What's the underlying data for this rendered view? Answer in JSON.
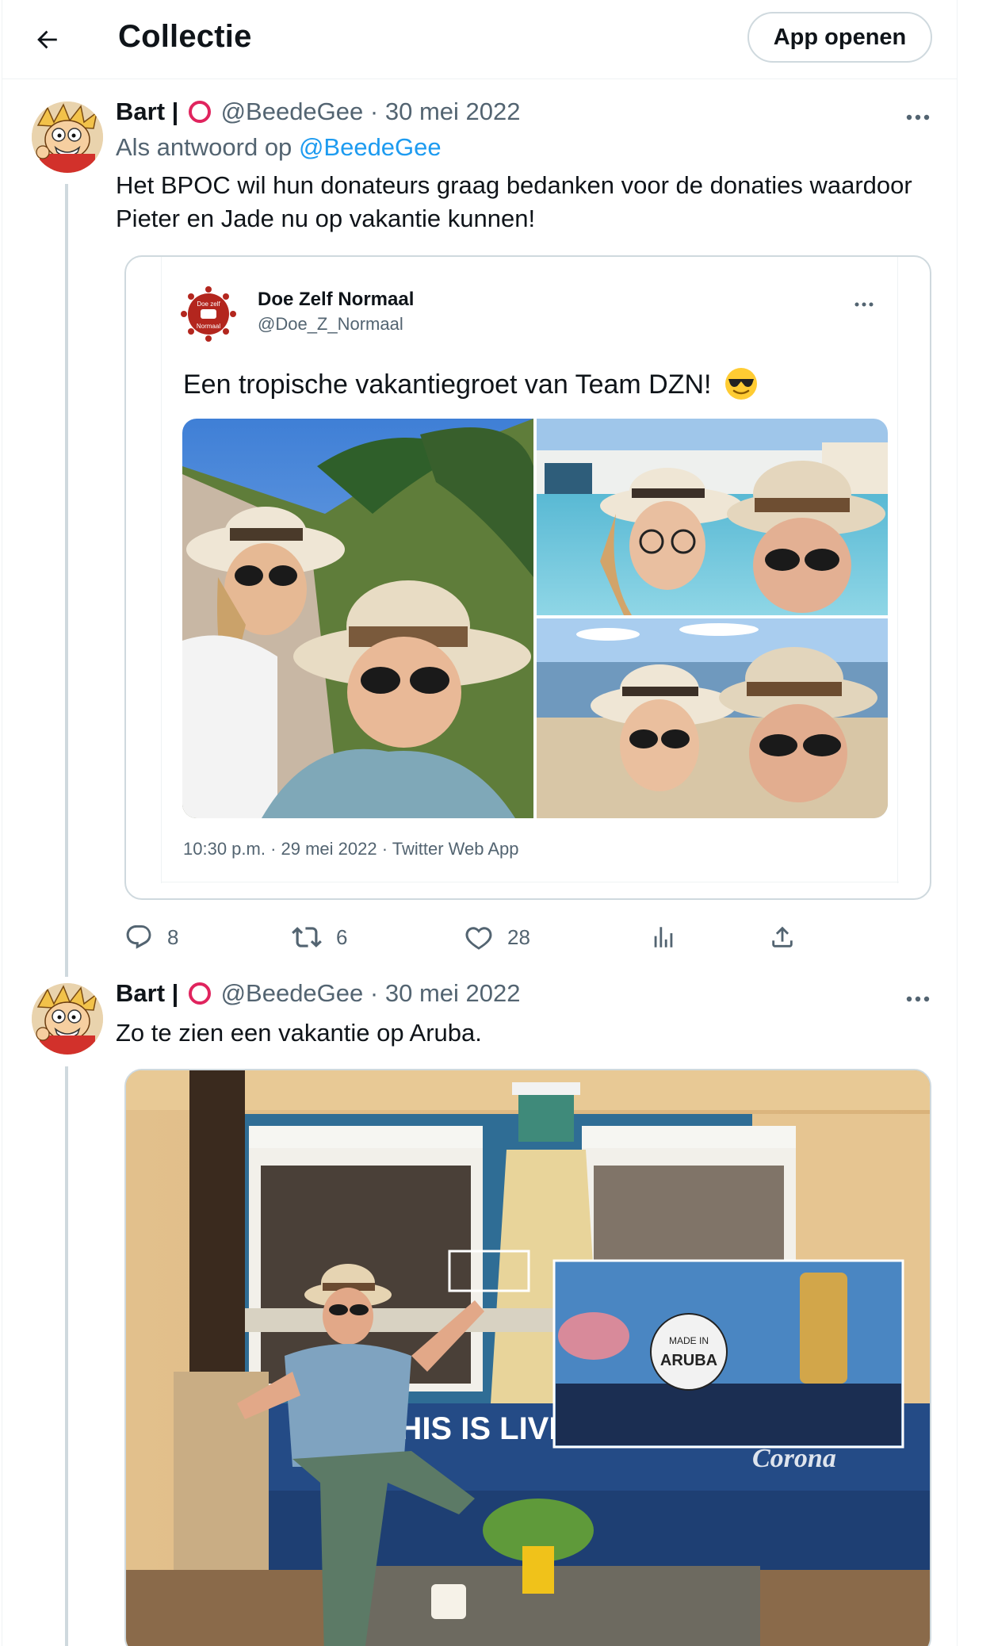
{
  "header": {
    "title": "Collectie",
    "open_app_label": "App openen"
  },
  "tweets": [
    {
      "name": "Bart |",
      "handle": "@BeedeGee",
      "dot": "·",
      "date": "30 mei 2022",
      "reply_prefix": "Als antwoord op",
      "reply_mention": "@BeedeGee",
      "text": "Het BPOC wil hun donateurs graag bedanken voor de donaties waardoor Pieter en Jade nu op vakantie kunnen!",
      "quote": {
        "name": "Doe Zelf Normaal",
        "handle": "@Doe_Z_Normaal",
        "text": "Een tropische vakantiegroet van Team DZN!",
        "emoji": "smiling-face-with-sunglasses-icon",
        "meta": "10:30 p.m. · 29 mei 2022 · Twitter Web App",
        "logo_text_top": "Doe zelf",
        "logo_text_bottom": "Normaal"
      },
      "actions": {
        "replies": "8",
        "retweets": "6",
        "likes": "28"
      }
    },
    {
      "name": "Bart |",
      "handle": "@BeedeGee",
      "dot": "·",
      "date": "30 mei 2022",
      "text": "Zo te zien een vakantie op Aruba.",
      "photo": {
        "banner_text": "THIS IS LIVING",
        "zoom_text_top": "MADE IN",
        "zoom_text": "ARUBA",
        "brand_text": "Corona"
      }
    }
  ],
  "colors": {
    "accent": "#1d9bf0",
    "muted": "#536471",
    "border": "#cfd9de",
    "ring": "#e0245e"
  }
}
